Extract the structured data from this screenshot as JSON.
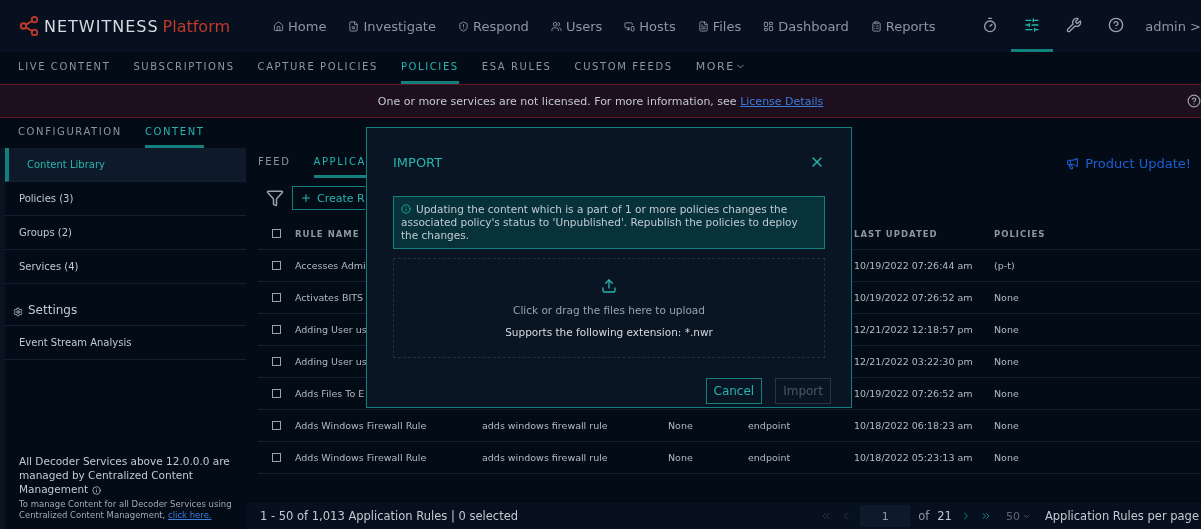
{
  "brand": {
    "name": "NETWITNESS",
    "product": "Platform"
  },
  "nav": [
    {
      "label": "Home"
    },
    {
      "label": "Investigate"
    },
    {
      "label": "Respond"
    },
    {
      "label": "Users"
    },
    {
      "label": "Hosts"
    },
    {
      "label": "Files"
    },
    {
      "label": "Dashboard"
    },
    {
      "label": "Reports"
    }
  ],
  "nav_tools": [
    {
      "selected": false
    },
    {
      "selected": true
    },
    {
      "selected": false
    },
    {
      "selected": false
    }
  ],
  "user": "admin >",
  "subnav": [
    {
      "label": "LIVE CONTENT",
      "selected": false
    },
    {
      "label": "SUBSCRIPTIONS",
      "selected": false
    },
    {
      "label": "CAPTURE POLICIES",
      "selected": false
    },
    {
      "label": "POLICIES",
      "selected": true
    },
    {
      "label": "ESA RULES",
      "selected": false
    },
    {
      "label": "CUSTOM FEEDS",
      "selected": false
    }
  ],
  "subnav_more": "MORE",
  "banner": {
    "text": "One or more services are not licensed. For more information, see ",
    "link": "License Details"
  },
  "config_tabs": [
    {
      "label": "CONFIGURATION",
      "selected": false
    },
    {
      "label": "CONTENT",
      "selected": true
    }
  ],
  "sidebar": {
    "items": [
      {
        "label": "Content Library",
        "selected": true
      },
      {
        "label": "Policies (3)",
        "selected": false
      },
      {
        "label": "Groups (2)",
        "selected": false
      },
      {
        "label": "Services (4)",
        "selected": false
      }
    ],
    "settings_header": "Settings",
    "settings_items": [
      {
        "label": "Event Stream Analysis",
        "selected": false
      }
    ],
    "note_title": "All Decoder Services above 12.0.0.0 are managed by Centralized Content Management",
    "note_text": "To manage Content for all Decoder Services using Centralized Content Management, ",
    "note_link": "click here."
  },
  "content_tabs": [
    {
      "label": "FEED",
      "selected": false
    },
    {
      "label": "APPLICA",
      "selected": true
    }
  ],
  "product_update": "Product Update!",
  "create_button": "Create R",
  "table": {
    "header_checked": false,
    "columns": [
      "RULE NAME",
      "LAST UPDATED",
      "POLICIES"
    ],
    "rows": [
      {
        "checked": false,
        "rule_name": "Accesses Admi",
        "last_updated": "10/19/2022 07:26:44 am",
        "policies": "(p-t)"
      },
      {
        "checked": false,
        "rule_name": "Activates BITS",
        "last_updated": "10/19/2022 07:26:52 am",
        "policies": "None"
      },
      {
        "checked": false,
        "rule_name": "Adding User us",
        "last_updated": "12/21/2022 12:18:57 pm",
        "policies": "None"
      },
      {
        "checked": false,
        "rule_name": "Adding User us",
        "last_updated": "12/21/2022 03:22:30 pm",
        "policies": "None"
      },
      {
        "checked": false,
        "rule_name": "Adds Files To E",
        "last_updated": "10/19/2022 07:26:52 am",
        "policies": "None"
      },
      {
        "checked": false,
        "rule_name": "Adds Windows Firewall Rule",
        "column_3": "adds windows firewall rule",
        "column_4": "None",
        "column_5": "endpoint",
        "last_updated": "10/18/2022 06:18:23 am",
        "policies": "None"
      },
      {
        "checked": false,
        "rule_name": "Adds Windows Firewall Rule",
        "column_3": "adds windows firewall rule",
        "column_4": "None",
        "column_5": "endpoint",
        "last_updated": "10/18/2022 05:23:13 am",
        "policies": "None"
      }
    ]
  },
  "footer": {
    "summary": "1 - 50 of 1,013 Application Rules | 0 selected",
    "page": "1",
    "of": "of",
    "total_pages": "21",
    "per_page": "50",
    "per_page_label": "Application Rules per page"
  },
  "modal": {
    "title": "IMPORT",
    "info": "Updating the content which is a part of 1 or more policies changes the associated policy's status to 'Unpublished'. Republish the policies to deploy the changes.",
    "drop_text": "Click or drag the files here to upload",
    "extension_text": "Supports the following extension: *.nwr",
    "buttons": [
      {
        "label": "Cancel",
        "disabled": false
      },
      {
        "label": "Import",
        "disabled": true
      }
    ]
  }
}
